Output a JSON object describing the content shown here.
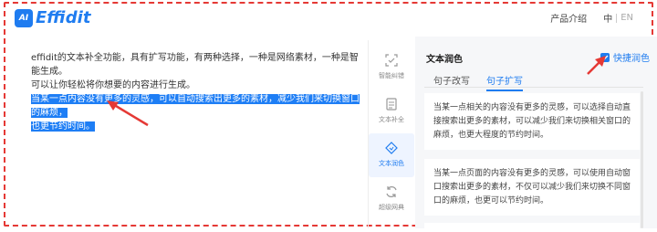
{
  "header": {
    "logo_badge": "AI",
    "logo_text": "Effidit",
    "nav": {
      "product_intro": "产品介绍",
      "lang_zh": "中",
      "lang_en": "EN"
    }
  },
  "editor": {
    "line1": "effidit的文本补全功能，具有扩写功能，有两种选择，一种是网络素材，一种是智能生成。",
    "line2": "可以让你轻松将你想要的内容进行生成。",
    "sel_line1": "当某一点内容没有更多的灵感，可以自动搜索出更多的素材，减少我们来切换窗口的麻烦，",
    "sel_line2": "也更节约时间。"
  },
  "tools": [
    {
      "label": "智能纠错",
      "icon": "scan-check-icon"
    },
    {
      "label": "文本补全",
      "icon": "document-icon"
    },
    {
      "label": "文本润色",
      "icon": "shield-diamond-icon"
    },
    {
      "label": "超级网典",
      "icon": "refresh-icon"
    }
  ],
  "panel": {
    "title": "文本润色",
    "quick_polish": "快捷润色",
    "tabs": [
      "句子改写",
      "句子扩写"
    ],
    "active_tab": "句子扩写",
    "results": [
      "当某一点相关的内容没有更多的灵感，可以选择自动直接搜索出更多的素材，可以减少我们来切换相关窗口的麻烦，也更大程度的节约时间。",
      "当某一点页面的内容没有更多的灵感，可以使用自动窗口搜索出更多的素材，不仅可以减少我们来切换不同窗口的麻烦，也更可以节约时间。"
    ]
  },
  "colors": {
    "accent": "#1f7cf0",
    "selection": "#1e7ef5",
    "annotation": "#e53935"
  }
}
